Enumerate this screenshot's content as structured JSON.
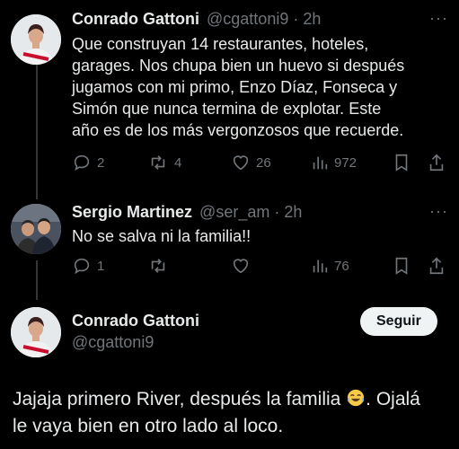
{
  "tweets": [
    {
      "name": "Conrado Gattoni",
      "handle": "@cgattoni9",
      "time": "· 2h",
      "text_lines": [
        "Que construyan 14 restaurantes, hoteles,",
        "garages. Nos chupa bien un huevo si después",
        "jugamos con mi primo, Enzo Díaz, Fonseca y",
        "Simón que nunca termina de explotar. Este",
        "año es de los más vergonzosos que recuerde."
      ],
      "replies": "2",
      "retweets": "4",
      "likes": "26",
      "views": "972"
    },
    {
      "name": "Sergio Martinez",
      "handle": "@ser_am",
      "time": "· 2h",
      "text_lines": [
        "No se salva ni la familia!!"
      ],
      "replies": "1",
      "retweets": "",
      "likes": "",
      "views": "76"
    }
  ],
  "main_tweet": {
    "name": "Conrado Gattoni",
    "handle": "@cgattoni9",
    "follow_label": "Seguir",
    "text_line1_a": "Jajaja primero River, después la familia",
    "text_line1_b": ". Ojalá",
    "text_line2": "le vaya bien en otro lado al loco.",
    "emoji": "tears-of-joy"
  },
  "icons": [
    "reply-icon",
    "retweet-icon",
    "like-icon",
    "views-icon",
    "bookmark-icon",
    "share-icon",
    "more-icon"
  ],
  "colors": {
    "background": "#000000",
    "text": "#e7e9ea",
    "muted": "#71767b",
    "button": "#eff3f4"
  }
}
